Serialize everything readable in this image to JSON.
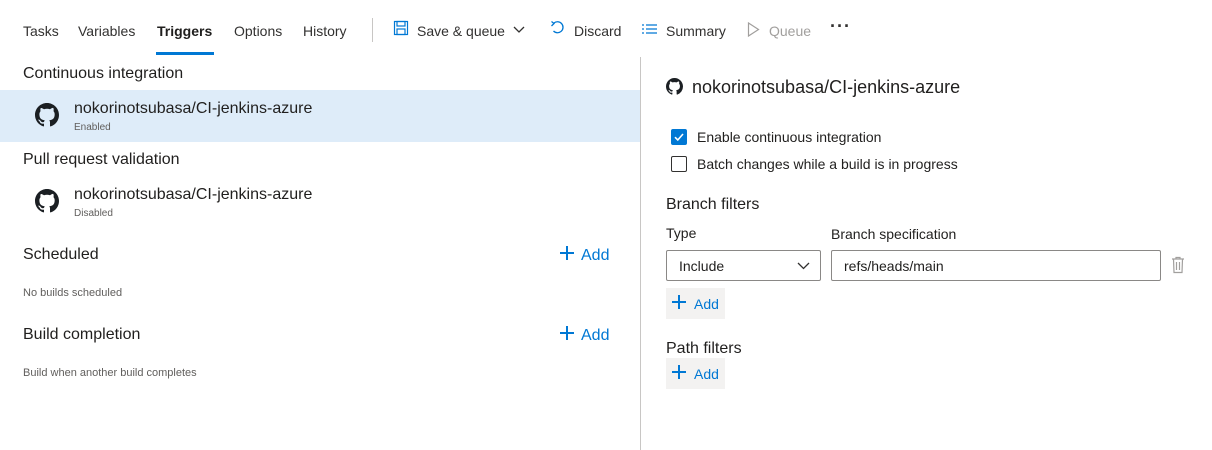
{
  "tabs": [
    {
      "label": "Tasks"
    },
    {
      "label": "Variables"
    },
    {
      "label": "Triggers"
    },
    {
      "label": "Options"
    },
    {
      "label": "History"
    }
  ],
  "toolbar": {
    "save_label": "Save & queue",
    "discard_label": "Discard",
    "summary_label": "Summary",
    "queue_label": "Queue",
    "more_label": "···",
    "accent_color": "#0078d4"
  },
  "left": {
    "ci_title": "Continuous integration",
    "ci_repo": {
      "name": "nokorinotsubasa/CI-jenkins-azure",
      "status": "Enabled"
    },
    "pr_title": "Pull request validation",
    "pr_repo": {
      "name": "nokorinotsubasa/CI-jenkins-azure",
      "status": "Disabled"
    },
    "scheduled_title": "Scheduled",
    "scheduled_add": "Add",
    "scheduled_note": "No builds scheduled",
    "build_completion_title": "Build completion",
    "build_completion_add": "Add",
    "build_completion_note": "Build when another build completes"
  },
  "right": {
    "repo_title": "nokorinotsubasa/CI-jenkins-azure",
    "enable_ci_label": "Enable continuous integration",
    "enable_ci_checked": true,
    "batch_label": "Batch changes while a build is in progress",
    "batch_checked": false,
    "branch_filters_heading": "Branch filters",
    "type_label": "Type",
    "type_value": "Include",
    "branch_spec_label": "Branch specification",
    "branch_spec_value": "refs/heads/main",
    "branch_add_label": "Add",
    "path_filters_heading": "Path filters",
    "path_add_label": "Add"
  }
}
